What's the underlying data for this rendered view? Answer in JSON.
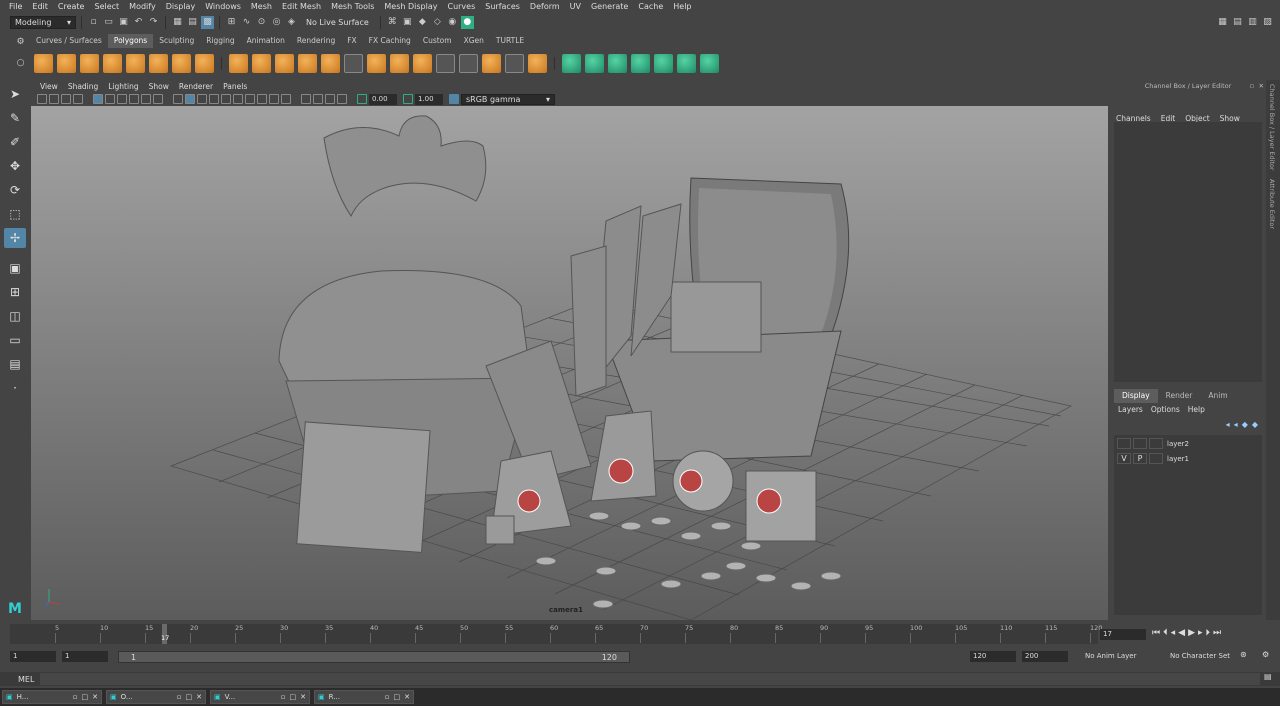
{
  "menu": [
    "File",
    "Edit",
    "Create",
    "Select",
    "Modify",
    "Display",
    "Windows",
    "Mesh",
    "Edit Mesh",
    "Mesh Tools",
    "Mesh Display",
    "Curves",
    "Surfaces",
    "Deform",
    "UV",
    "Generate",
    "Cache",
    "Help"
  ],
  "status_line": {
    "mode": "Modeling",
    "live_surface": "No Live Surface"
  },
  "shelf_tabs": [
    "Curves / Surfaces",
    "Polygons",
    "Sculpting",
    "Rigging",
    "Animation",
    "Rendering",
    "FX",
    "FX Caching",
    "Custom",
    "XGen",
    "TURTLE"
  ],
  "shelf_active": "Polygons",
  "panel_menu": [
    "View",
    "Shading",
    "Lighting",
    "Show",
    "Renderer",
    "Panels"
  ],
  "panel_toolbar": {
    "exposure": "0.00",
    "gamma": "1.00",
    "color_space": "sRGB gamma"
  },
  "viewport": {
    "camera": "camera1"
  },
  "channel_box": {
    "title": "Channel Box / Layer Editor",
    "menus": [
      "Channels",
      "Edit",
      "Object",
      "Show"
    ]
  },
  "layer_editor": {
    "tabs": [
      "Display",
      "Render",
      "Anim"
    ],
    "active_tab": "Display",
    "menus": [
      "Layers",
      "Options",
      "Help"
    ],
    "layers": [
      {
        "v": "",
        "p": "",
        "name": "layer2"
      },
      {
        "v": "V",
        "p": "P",
        "name": "layer1"
      }
    ]
  },
  "side_tabs": [
    "Channel Box / Layer Editor",
    "Attribute Editor"
  ],
  "time_slider": {
    "ticks": [
      "5",
      "10",
      "15",
      "20",
      "25",
      "30",
      "35",
      "40",
      "45",
      "50",
      "55",
      "60",
      "65",
      "70",
      "75",
      "80",
      "85",
      "90",
      "95",
      "100",
      "105",
      "110",
      "115",
      "120"
    ],
    "current_frame": "17",
    "current_frame_field": "17"
  },
  "range_slider": {
    "start": "1",
    "playback_start": "1",
    "range_start_label": "1",
    "range_end_label": "120",
    "playback_end": "120",
    "end": "200",
    "anim_layer": "No Anim Layer",
    "character_set": "No Character Set"
  },
  "command_line": {
    "label": "MEL"
  },
  "taskbar": [
    {
      "label": "H..."
    },
    {
      "label": "O..."
    },
    {
      "label": "V..."
    },
    {
      "label": "R..."
    }
  ],
  "colors": {
    "accent": "#5285a6",
    "shelf_orange": "#e5963a",
    "shelf_green": "#2fae83",
    "viewport_bg": "#a9a9a9"
  }
}
